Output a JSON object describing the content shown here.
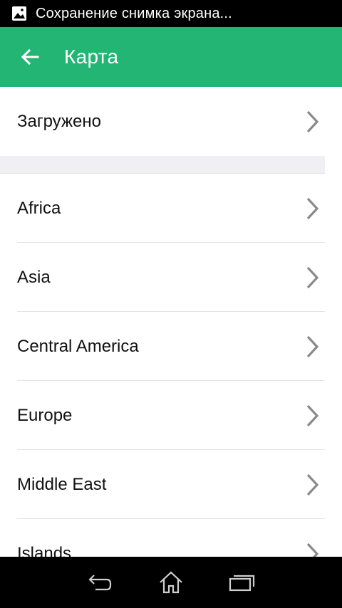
{
  "status_bar": {
    "icon": "image-icon",
    "text": "Сохранение снимка экрана..."
  },
  "app_bar": {
    "back_icon": "arrow-left-icon",
    "title": "Карта",
    "color": "#22b573"
  },
  "downloaded": {
    "label": "Загружено"
  },
  "regions": [
    {
      "label": "Africa"
    },
    {
      "label": "Asia"
    },
    {
      "label": "Central America"
    },
    {
      "label": "Europe"
    },
    {
      "label": "Middle East"
    },
    {
      "label": "Islands"
    }
  ],
  "nav_bar": {
    "back_icon": "nav-back-icon",
    "home_icon": "nav-home-icon",
    "recents_icon": "nav-recents-icon"
  }
}
